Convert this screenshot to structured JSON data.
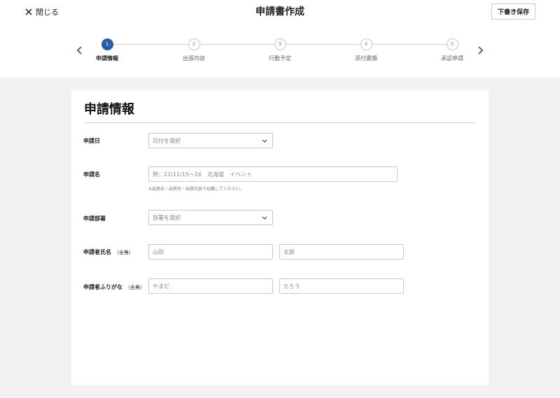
{
  "header": {
    "close_label": "閉じる",
    "title": "申請書作成",
    "draft_save_label": "下書き保存"
  },
  "stepper": {
    "steps": [
      {
        "number": "1",
        "label": "申請情報",
        "active": true
      },
      {
        "number": "2",
        "label": "出張内容",
        "active": false
      },
      {
        "number": "3",
        "label": "行動予定",
        "active": false
      },
      {
        "number": "4",
        "label": "添付書類",
        "active": false
      },
      {
        "number": "5",
        "label": "承認申請",
        "active": false
      }
    ]
  },
  "form": {
    "section_title": "申請情報",
    "application_date": {
      "label": "申請日",
      "placeholder": "日付を選択"
    },
    "application_name": {
      "label": "申請名",
      "placeholder": "例：22/11/15〜16　北海道　イベント",
      "hint": "※出張日・出張先・出張内容で記載してください。"
    },
    "department": {
      "label": "申請部署",
      "placeholder": "部署を選択"
    },
    "applicant_name": {
      "label": "申請者氏名",
      "sub": "（全角）",
      "last_placeholder": "山田",
      "first_placeholder": "太郎"
    },
    "applicant_kana": {
      "label": "申請者ふりがな",
      "sub": "（全角）",
      "last_placeholder": "やまだ",
      "first_placeholder": "たろう"
    }
  },
  "colors": {
    "accent": "#2a5fa6",
    "background": "#f2f2f2",
    "border": "#c8c8c8"
  }
}
